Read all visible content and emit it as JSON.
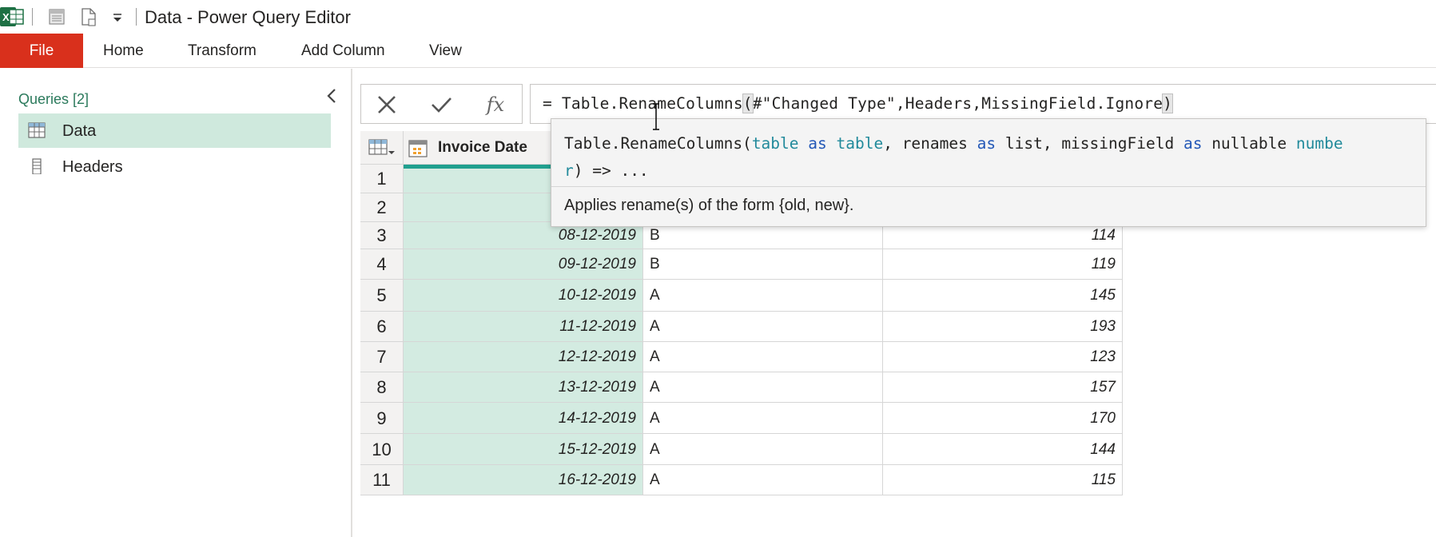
{
  "window": {
    "title": "Data - Power Query Editor"
  },
  "ribbon": {
    "tabs": [
      {
        "label": "File"
      },
      {
        "label": "Home"
      },
      {
        "label": "Transform"
      },
      {
        "label": "Add Column"
      },
      {
        "label": "View"
      }
    ]
  },
  "queries": {
    "title": "Queries [2]",
    "items": [
      {
        "label": "Data",
        "icon": "table-icon",
        "selected": true
      },
      {
        "label": "Headers",
        "icon": "list-icon",
        "selected": false
      }
    ]
  },
  "formula_bar": {
    "cancel_icon": "close-icon",
    "commit_icon": "check-icon",
    "fx_label": "fx",
    "equals": "=",
    "prefix": "Table.RenameColumns",
    "open_paren": "(",
    "args": "#\"Changed Type\",Headers,MissingField.Ignore",
    "close_paren": ")"
  },
  "tooltip": {
    "fn": "Table.RenameColumns(",
    "p1_name": "table",
    "p1_as": "as",
    "p1_type": "table",
    "comma1": ", ",
    "p2_name": "renames",
    "p2_as": "as",
    "p2_type": "list",
    "comma2": ", ",
    "p3_name": "missingField",
    "p3_as": "as",
    "p3_nullable": "nullable",
    "p3_type_line1": "numbe",
    "p3_type_line2": "r",
    "tail": ") => ...",
    "description": "Applies rename(s) of the form {old, new}."
  },
  "grid": {
    "column_header": "Invoice Date",
    "rows": [
      {
        "n": "1",
        "date": "",
        "cat": "",
        "val": ""
      },
      {
        "n": "2",
        "date": "",
        "cat": "",
        "val": ""
      },
      {
        "n": "3",
        "date": "08-12-2019",
        "cat": "B",
        "val": "114"
      },
      {
        "n": "4",
        "date": "09-12-2019",
        "cat": "B",
        "val": "119"
      },
      {
        "n": "5",
        "date": "10-12-2019",
        "cat": "A",
        "val": "145"
      },
      {
        "n": "6",
        "date": "11-12-2019",
        "cat": "A",
        "val": "193"
      },
      {
        "n": "7",
        "date": "12-12-2019",
        "cat": "A",
        "val": "123"
      },
      {
        "n": "8",
        "date": "13-12-2019",
        "cat": "A",
        "val": "157"
      },
      {
        "n": "9",
        "date": "14-12-2019",
        "cat": "A",
        "val": "170"
      },
      {
        "n": "10",
        "date": "15-12-2019",
        "cat": "A",
        "val": "144"
      },
      {
        "n": "11",
        "date": "16-12-2019",
        "cat": "A",
        "val": "115"
      }
    ]
  },
  "colors": {
    "file_tab": "#d9301c",
    "selection": "#cfe9dd",
    "accent": "#21a08f"
  }
}
